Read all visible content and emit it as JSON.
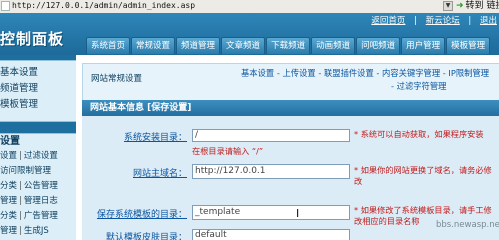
{
  "browser": {
    "url": "http://127.0.0.1/admin/admin_index.asp",
    "go_label": "转到",
    "links_label": "链接"
  },
  "header": {
    "logo": "控制面板",
    "top_links": [
      "返回首页",
      "新云论坛",
      "退出"
    ],
    "nav_tabs": [
      "系统首页",
      "常规设置",
      "频道管理",
      "文章频道",
      "下载频道",
      "动画频道",
      "问吧频道",
      "用户管理",
      "模板管理"
    ]
  },
  "sidebar": {
    "block1": [
      "基本设置",
      "频道管理",
      "模板管理"
    ],
    "block2_head": "设置",
    "block2_rows": [
      [
        "设置",
        "过滤设置"
      ],
      [
        "访问限制管理"
      ],
      [
        "分类",
        "公告管理"
      ],
      [
        "管理",
        "管理日志"
      ],
      [
        "分类",
        "广告管理"
      ],
      [
        "管理",
        "生成JS"
      ]
    ]
  },
  "content": {
    "subbar_title": "网站常规设置",
    "subbar_links": [
      "基本设置",
      "上传设置",
      "联盟插件设置",
      "内容关键字管理",
      "IP限制管理",
      "过滤字符管理"
    ],
    "panel_title": "网站基本信息 [保存设置]",
    "rows": [
      {
        "label": "系统安装目录：",
        "value": "/",
        "hint": "* 系统可以自动获取，如果程序安装",
        "hint2": "在根目录请输入 “/”"
      },
      {
        "label": "网站主域名：",
        "value": "http://127.0.0.1",
        "hint": "* 如果你的网站更换了域名，请务必修改"
      },
      {
        "label": "保存系统模板的目录：",
        "value": "_template",
        "hint": "* 如果修改了系统模板目录，请手工修改相应的目录名称"
      },
      {
        "label": "默认模板皮肤目录：",
        "value": "default",
        "hint": ""
      }
    ]
  },
  "watermark": "bbs.newasp.net",
  "icons": {
    "go": "green-arrow-icon",
    "page": "page-icon",
    "dropdown": "chevron-down-icon",
    "cursor": "text-cursor-icon"
  }
}
